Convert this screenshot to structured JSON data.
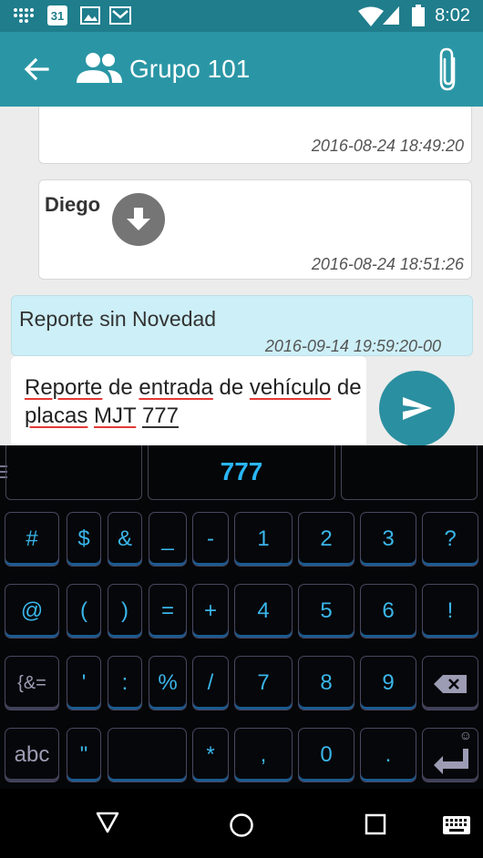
{
  "status_bar": {
    "time": "8:02",
    "calendar_day": "31"
  },
  "app_bar": {
    "title": "Grupo 101"
  },
  "messages": [
    {
      "time": "2016-08-24 18:49:20"
    },
    {
      "sender": "Diego",
      "time": "2016-08-24 18:51:26"
    },
    {
      "text": "Reporte sin Novedad",
      "time": "2016-09-14 19:59:20-00"
    }
  ],
  "composer": {
    "value_parts": [
      "Reporte",
      " de ",
      "entrada",
      " de ",
      "vehículo",
      " de ",
      "placas",
      " ",
      "MJT",
      " ",
      "777"
    ]
  },
  "keyboard": {
    "suggestion": "777",
    "rows": [
      [
        "#",
        "$",
        "&",
        "_",
        "-",
        "1",
        "2",
        "3",
        "?"
      ],
      [
        "@",
        "(",
        ")",
        "=",
        "+",
        "4",
        "5",
        "6",
        "!"
      ],
      [
        "{&=",
        "'",
        ":",
        "%",
        "/",
        "7",
        "8",
        "9",
        "backspace"
      ],
      [
        "abc",
        "\"",
        "space",
        "*",
        ",",
        "0",
        ".",
        "enter"
      ]
    ]
  },
  "colors": {
    "status_bar": "#1f7d8c",
    "app_bar": "#2a96a5",
    "outgoing_bubble": "#cdeff7",
    "send_button": "#2a8fa0",
    "key_text": "#3ab6ea"
  }
}
